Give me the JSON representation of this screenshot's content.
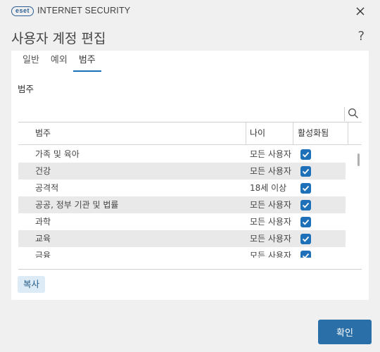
{
  "app": {
    "logo_text": "eset",
    "title": "INTERNET SECURITY"
  },
  "dialog": {
    "title": "사용자 계정 편집",
    "help": "?"
  },
  "tabs": [
    {
      "label": "일반",
      "active": false
    },
    {
      "label": "예외",
      "active": false
    },
    {
      "label": "범주",
      "active": true
    }
  ],
  "section_label": "범주",
  "search": {
    "value": "",
    "placeholder": ""
  },
  "table": {
    "headers": {
      "category": "범주",
      "age": "나이",
      "enabled": "활성화됨"
    },
    "rows": [
      {
        "category": "가족 및 육아",
        "age": "모든 사용자",
        "enabled": true
      },
      {
        "category": "건강",
        "age": "모든 사용자",
        "enabled": true
      },
      {
        "category": "공격적",
        "age": "18세 이상",
        "enabled": true
      },
      {
        "category": "공공, 정부 기관 및 법률",
        "age": "모든 사용자",
        "enabled": true
      },
      {
        "category": "과학",
        "age": "모든 사용자",
        "enabled": true
      },
      {
        "category": "교육",
        "age": "모든 사용자",
        "enabled": true
      },
      {
        "category": "금융",
        "age": "모든 사용자",
        "enabled": true
      }
    ]
  },
  "buttons": {
    "copy": "복사",
    "ok": "확인"
  },
  "colors": {
    "accent": "#1e70b9",
    "ok_button": "#2a6fa8",
    "copy_button_bg": "#dcebf5",
    "window_bg": "#f0f0f1"
  }
}
